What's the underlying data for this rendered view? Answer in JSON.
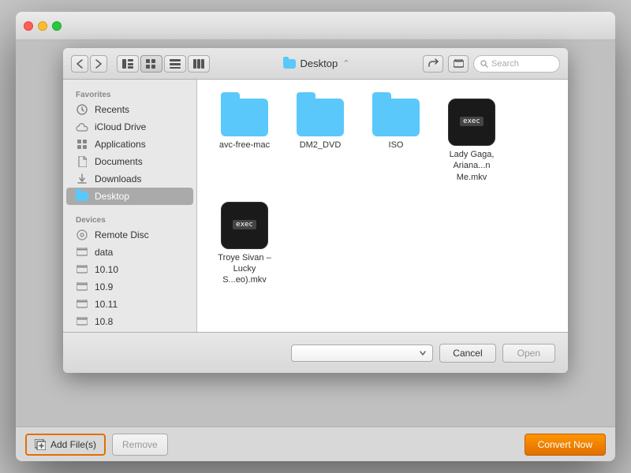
{
  "outer": {
    "title": ""
  },
  "titlebar": {
    "title": "Desktop",
    "search_placeholder": "Search"
  },
  "sidebar": {
    "favorites_label": "Favorites",
    "devices_label": "Devices",
    "items": [
      {
        "id": "recents",
        "label": "Recents",
        "icon": "clock"
      },
      {
        "id": "icloud",
        "label": "iCloud Drive",
        "icon": "cloud"
      },
      {
        "id": "applications",
        "label": "Applications",
        "icon": "folder"
      },
      {
        "id": "documents",
        "label": "Documents",
        "icon": "doc"
      },
      {
        "id": "downloads",
        "label": "Downloads",
        "icon": "download"
      },
      {
        "id": "desktop",
        "label": "Desktop",
        "icon": "folder",
        "active": true
      }
    ],
    "devices": [
      {
        "id": "remote-disc",
        "label": "Remote Disc",
        "icon": "disc"
      },
      {
        "id": "data",
        "label": "data",
        "icon": "drive"
      },
      {
        "id": "os1010",
        "label": "10.10",
        "icon": "drive"
      },
      {
        "id": "os109",
        "label": "10.9",
        "icon": "drive"
      },
      {
        "id": "os1011",
        "label": "10.11",
        "icon": "drive"
      },
      {
        "id": "os108",
        "label": "10.8",
        "icon": "drive"
      }
    ]
  },
  "files": [
    {
      "id": "avc-free-mac",
      "name": "avc-free-mac",
      "type": "folder"
    },
    {
      "id": "dm2-dvd",
      "name": "DM2_DVD",
      "type": "folder"
    },
    {
      "id": "iso",
      "name": "ISO",
      "type": "folder"
    },
    {
      "id": "lady-gaga",
      "name": "Lady Gaga, Ariana...n Me.mkv",
      "type": "exec"
    },
    {
      "id": "troye-sivan",
      "name": "Troye Sivan – Lucky S...eo).mkv",
      "type": "exec"
    }
  ],
  "buttons": {
    "cancel": "Cancel",
    "open": "Open",
    "add_files": "Add File(s)",
    "remove": "Remove",
    "convert": "Convert Now"
  }
}
